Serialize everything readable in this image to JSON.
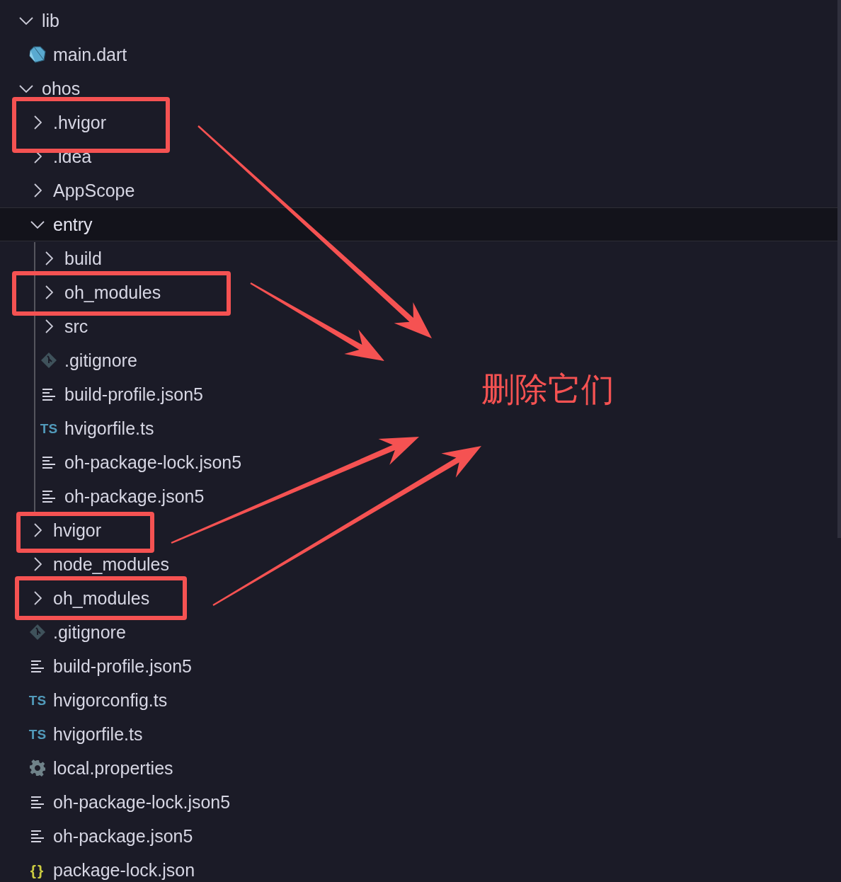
{
  "explorer": {
    "tree": [
      {
        "label": "lib",
        "kind": "folder",
        "expanded": true,
        "selected": false,
        "marked": false,
        "children": [
          {
            "label": "main.dart",
            "kind": "dart",
            "selected": false,
            "marked": false
          }
        ]
      },
      {
        "label": "ohos",
        "kind": "folder",
        "expanded": true,
        "selected": false,
        "marked": false,
        "children": [
          {
            "label": ".hvigor",
            "kind": "folder",
            "expanded": false,
            "selected": false,
            "marked": true
          },
          {
            "label": ".idea",
            "kind": "folder",
            "expanded": false,
            "selected": false,
            "marked": false
          },
          {
            "label": "AppScope",
            "kind": "folder",
            "expanded": false,
            "selected": false,
            "marked": false
          },
          {
            "label": "entry",
            "kind": "folder",
            "expanded": true,
            "selected": true,
            "marked": false,
            "children": [
              {
                "label": "build",
                "kind": "folder",
                "expanded": false,
                "selected": false,
                "marked": false
              },
              {
                "label": "oh_modules",
                "kind": "folder",
                "expanded": false,
                "selected": false,
                "marked": true
              },
              {
                "label": "src",
                "kind": "folder",
                "expanded": false,
                "selected": false,
                "marked": false
              },
              {
                "label": ".gitignore",
                "kind": "gitignore",
                "selected": false,
                "marked": false
              },
              {
                "label": "build-profile.json5",
                "kind": "json5",
                "selected": false,
                "marked": false
              },
              {
                "label": "hvigorfile.ts",
                "kind": "ts",
                "icon_text": "TS",
                "selected": false,
                "marked": false
              },
              {
                "label": "oh-package-lock.json5",
                "kind": "json5",
                "selected": false,
                "marked": false
              },
              {
                "label": "oh-package.json5",
                "kind": "json5",
                "selected": false,
                "marked": false
              }
            ]
          },
          {
            "label": "hvigor",
            "kind": "folder",
            "expanded": false,
            "selected": false,
            "marked": true
          },
          {
            "label": "node_modules",
            "kind": "folder",
            "expanded": false,
            "selected": false,
            "marked": false
          },
          {
            "label": "oh_modules",
            "kind": "folder",
            "expanded": false,
            "selected": false,
            "marked": true
          },
          {
            "label": ".gitignore",
            "kind": "gitignore",
            "selected": false,
            "marked": false
          },
          {
            "label": "build-profile.json5",
            "kind": "json5",
            "selected": false,
            "marked": false
          },
          {
            "label": "hvigorconfig.ts",
            "kind": "ts",
            "icon_text": "TS",
            "selected": false,
            "marked": false
          },
          {
            "label": "hvigorfile.ts",
            "kind": "ts",
            "icon_text": "TS",
            "selected": false,
            "marked": false
          },
          {
            "label": "local.properties",
            "kind": "properties",
            "selected": false,
            "marked": false
          },
          {
            "label": "oh-package-lock.json5",
            "kind": "json5",
            "selected": false,
            "marked": false
          },
          {
            "label": "oh-package.json5",
            "kind": "json5",
            "selected": false,
            "marked": false
          },
          {
            "label": "package-lock.json",
            "kind": "json",
            "icon_text": "{}",
            "selected": false,
            "marked": false
          }
        ]
      }
    ]
  },
  "annotation": {
    "text": "删除它们"
  }
}
